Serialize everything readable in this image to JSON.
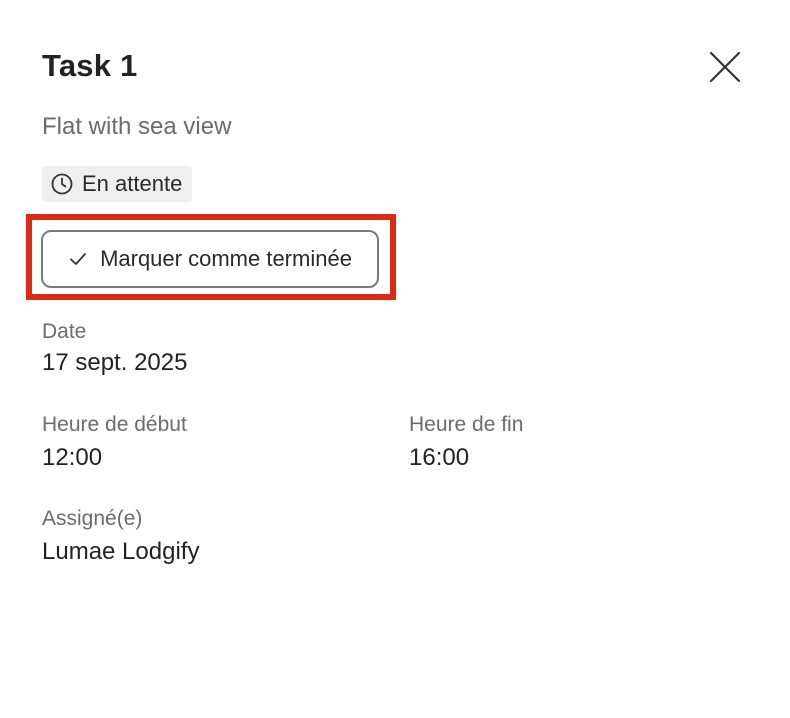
{
  "task": {
    "title": "Task 1",
    "property": "Flat with sea view",
    "status": {
      "label": "En attente",
      "icon": "clock-icon"
    },
    "mark_done_button": {
      "label": "Marquer comme terminée",
      "icon": "checkmark-icon"
    },
    "close_icon": "close-icon",
    "fields": {
      "date_label": "Date",
      "date_value": "17 sept. 2025",
      "start_label": "Heure de début",
      "start_value": "12:00",
      "end_label": "Heure de fin",
      "end_value": "16:00",
      "assignee_label": "Assigné(e)",
      "assignee_value": "Lumae Lodgify"
    }
  },
  "colors": {
    "highlight": "#dd2a12",
    "badge_bg": "#efefef",
    "label_gray": "#6b6b6b"
  }
}
